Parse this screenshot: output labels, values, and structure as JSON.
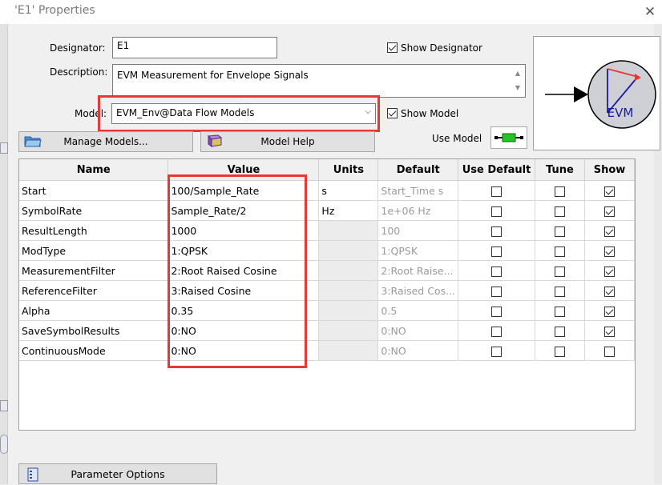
{
  "window": {
    "title": "'E1' Properties",
    "close_glyph": "✕"
  },
  "designator": {
    "label": "Designator:",
    "value": "E1",
    "show_label": "Show Designator",
    "show_checked": true
  },
  "description": {
    "label": "Description:",
    "value": "EVM Measurement for Envelope Signals"
  },
  "model": {
    "label": "Model:",
    "value": "EVM_Env@Data Flow Models",
    "show_label": "Show Model",
    "show_checked": true
  },
  "buttons": {
    "manage_models": "Manage Models...",
    "model_help": "Model Help",
    "use_model": "Use Model",
    "parameter_options": "Parameter Options"
  },
  "preview": {
    "symbol_text": "EVM"
  },
  "table": {
    "headers": [
      "Name",
      "Value",
      "Units",
      "Default",
      "Use Default",
      "Tune",
      "Show"
    ],
    "rows": [
      {
        "name": "Start",
        "value": "100/Sample_Rate",
        "units": "s",
        "default": "Start_Time s",
        "use_default": false,
        "tune": false,
        "show": true
      },
      {
        "name": "SymbolRate",
        "value": "Sample_Rate/2",
        "units": "Hz",
        "default": "1e+06 Hz",
        "use_default": false,
        "tune": false,
        "show": true
      },
      {
        "name": "ResultLength",
        "value": "1000",
        "units": "",
        "default": "100",
        "use_default": false,
        "tune": false,
        "show": true
      },
      {
        "name": "ModType",
        "value": "1:QPSK",
        "units": "",
        "default": "1:QPSK",
        "use_default": false,
        "tune": false,
        "show": true
      },
      {
        "name": "MeasurementFilter",
        "value": "2:Root Raised Cosine",
        "units": "",
        "default": "2:Root Raise...",
        "use_default": false,
        "tune": false,
        "show": true
      },
      {
        "name": "ReferenceFilter",
        "value": "3:Raised Cosine",
        "units": "",
        "default": "3:Raised Cos...",
        "use_default": false,
        "tune": false,
        "show": true
      },
      {
        "name": "Alpha",
        "value": "0.35",
        "units": "",
        "default": "0.5",
        "use_default": false,
        "tune": false,
        "show": true
      },
      {
        "name": "SaveSymbolResults",
        "value": "0:NO",
        "units": "",
        "default": "0:NO",
        "use_default": false,
        "tune": false,
        "show": true
      },
      {
        "name": "ContinuousMode",
        "value": "0:NO",
        "units": "",
        "default": "0:NO",
        "use_default": false,
        "tune": false,
        "show": false
      }
    ]
  },
  "colors": {
    "highlight": "#e53935",
    "symbol_fill": "#cfcfd6",
    "symbol_stroke": "#1a1aa0",
    "arrow_red": "#e53935"
  }
}
